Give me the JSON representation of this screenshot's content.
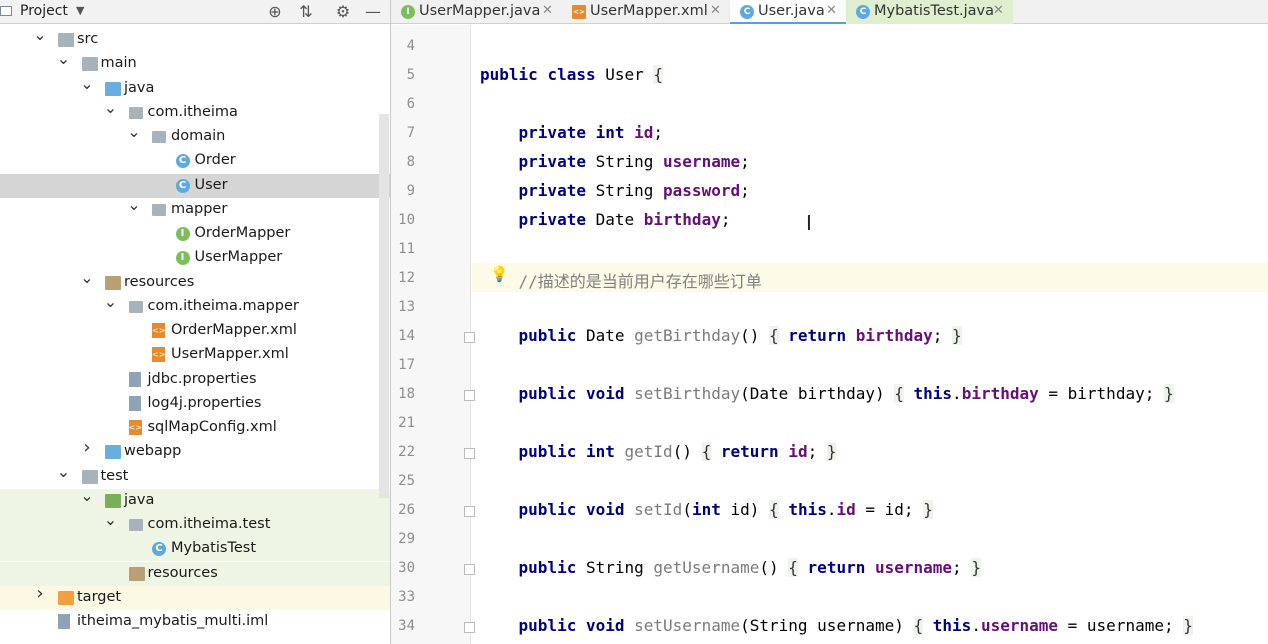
{
  "project_panel": {
    "title": "Project",
    "tree": [
      {
        "label": "src",
        "icon": "folder-gray",
        "chevron": "down",
        "depth": 0
      },
      {
        "label": "main",
        "icon": "folder-gray",
        "chevron": "down",
        "depth": 1
      },
      {
        "label": "java",
        "icon": "folder-blue",
        "chevron": "down",
        "depth": 2
      },
      {
        "label": "com.itheima",
        "icon": "package",
        "chevron": "down",
        "depth": 3
      },
      {
        "label": "domain",
        "icon": "package",
        "chevron": "down",
        "depth": 4
      },
      {
        "label": "Order",
        "icon": "class",
        "chevron": "",
        "depth": 5
      },
      {
        "label": "User",
        "icon": "class",
        "chevron": "",
        "depth": 5,
        "selected": true
      },
      {
        "label": "mapper",
        "icon": "package",
        "chevron": "down",
        "depth": 4
      },
      {
        "label": "OrderMapper",
        "icon": "interface",
        "chevron": "",
        "depth": 5
      },
      {
        "label": "UserMapper",
        "icon": "interface",
        "chevron": "",
        "depth": 5
      },
      {
        "label": "resources",
        "icon": "folder-res",
        "chevron": "down",
        "depth": 2
      },
      {
        "label": "com.itheima.mapper",
        "icon": "package",
        "chevron": "down",
        "depth": 3
      },
      {
        "label": "OrderMapper.xml",
        "icon": "xml",
        "chevron": "",
        "depth": 4
      },
      {
        "label": "UserMapper.xml",
        "icon": "xml",
        "chevron": "",
        "depth": 4
      },
      {
        "label": "jdbc.properties",
        "icon": "properties",
        "chevron": "",
        "depth": 3
      },
      {
        "label": "log4j.properties",
        "icon": "properties",
        "chevron": "",
        "depth": 3
      },
      {
        "label": "sqlMapConfig.xml",
        "icon": "xml",
        "chevron": "",
        "depth": 3
      },
      {
        "label": "webapp",
        "icon": "folder-blue",
        "chevron": "right",
        "depth": 2
      },
      {
        "label": "test",
        "icon": "folder-gray",
        "chevron": "down",
        "depth": 1
      },
      {
        "label": "java",
        "icon": "folder-green",
        "chevron": "down",
        "depth": 2,
        "tint": "green"
      },
      {
        "label": "com.itheima.test",
        "icon": "package",
        "chevron": "down",
        "depth": 3,
        "tint": "green"
      },
      {
        "label": "MybatisTest",
        "icon": "class-test",
        "chevron": "",
        "depth": 4,
        "tint": "green"
      },
      {
        "label": "resources",
        "icon": "folder-res",
        "chevron": "",
        "depth": 3,
        "tint": "green"
      },
      {
        "label": "target",
        "icon": "folder-orange",
        "chevron": "right",
        "depth": 0,
        "tint": "yellow"
      },
      {
        "label": "itheima_mybatis_multi.iml",
        "icon": "iml",
        "chevron": "",
        "depth": 0
      }
    ]
  },
  "tabs": [
    {
      "label": "UserMapper.java",
      "icon": "interface",
      "active": false
    },
    {
      "label": "UserMapper.xml",
      "icon": "xml",
      "active": false
    },
    {
      "label": "User.java",
      "icon": "class",
      "active": true
    },
    {
      "label": "MybatisTest.java",
      "icon": "class-test",
      "active": false
    }
  ],
  "editor": {
    "lines": [
      {
        "num": "4",
        "code": ""
      },
      {
        "num": "5",
        "code": "public class User {"
      },
      {
        "num": "6",
        "code": ""
      },
      {
        "num": "7",
        "code": "    private int id;"
      },
      {
        "num": "8",
        "code": "    private String username;"
      },
      {
        "num": "9",
        "code": "    private String password;"
      },
      {
        "num": "10",
        "code": "    private Date birthday;"
      },
      {
        "num": "11",
        "code": ""
      },
      {
        "num": "12",
        "code": "    //描述的是当前用户存在哪些订单"
      },
      {
        "num": "13",
        "code": ""
      },
      {
        "num": "14",
        "code": "    public Date getBirthday() { return birthday; }"
      },
      {
        "num": "17",
        "code": ""
      },
      {
        "num": "18",
        "code": "    public void setBirthday(Date birthday) { this.birthday = birthday; }"
      },
      {
        "num": "21",
        "code": ""
      },
      {
        "num": "22",
        "code": "    public int getId() { return id; }"
      },
      {
        "num": "25",
        "code": ""
      },
      {
        "num": "26",
        "code": "    public void setId(int id) { this.id = id; }"
      },
      {
        "num": "29",
        "code": ""
      },
      {
        "num": "30",
        "code": "    public String getUsername() { return username; }"
      },
      {
        "num": "33",
        "code": ""
      },
      {
        "num": "34",
        "code": "    public void setUsername(String username) { this.username = username; }"
      }
    ]
  }
}
